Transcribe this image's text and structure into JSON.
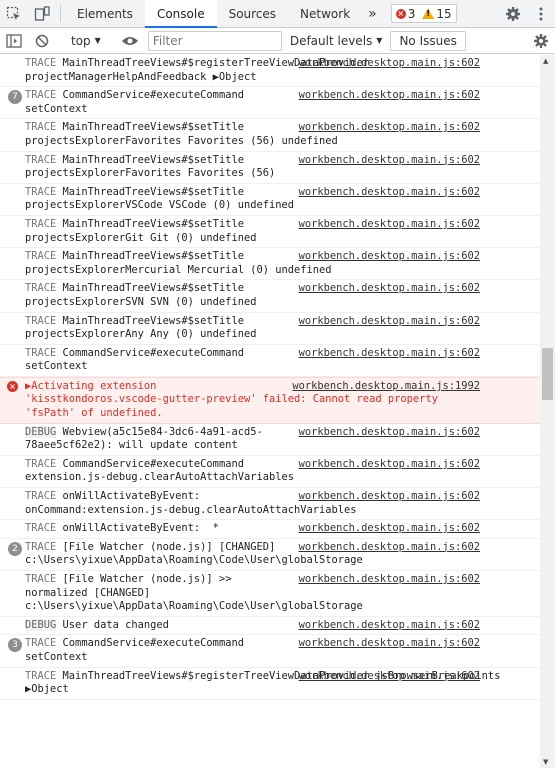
{
  "tabs": [
    {
      "label": "Elements"
    },
    {
      "label": "Console"
    },
    {
      "label": "Sources"
    },
    {
      "label": "Network"
    }
  ],
  "more_tabs": "»",
  "counts": {
    "errors": "3",
    "warnings": "15"
  },
  "toolbar": {
    "context": "top",
    "filter_placeholder": "Filter",
    "levels": "Default levels",
    "issues": "No Issues"
  },
  "colors": {
    "accent": "#1a73e8",
    "error": "#d93025",
    "warning": "#f9ab00"
  },
  "entries": [
    {
      "badge": "",
      "level": "TRACE",
      "source": "workbench.desktop.main.js:602",
      "lines": [
        "MainThreadTreeViews#$registerTreeViewDataProvider",
        "projectManagerHelpAndFeedback ▶Object"
      ]
    },
    {
      "badge": "7",
      "level": "TRACE",
      "source": "workbench.desktop.main.js:602",
      "lines": [
        "CommandService#executeCommand",
        "setContext"
      ]
    },
    {
      "badge": "",
      "level": "TRACE",
      "source": "workbench.desktop.main.js:602",
      "lines": [
        "MainThreadTreeViews#$setTitle",
        "projectsExplorerFavorites Favorites (56) undefined"
      ]
    },
    {
      "badge": "",
      "level": "TRACE",
      "source": "workbench.desktop.main.js:602",
      "lines": [
        "MainThreadTreeViews#$setTitle",
        "projectsExplorerFavorites Favorites (56)"
      ]
    },
    {
      "badge": "",
      "level": "TRACE",
      "source": "workbench.desktop.main.js:602",
      "lines": [
        "MainThreadTreeViews#$setTitle",
        "projectsExplorerVSCode VSCode (0) undefined"
      ]
    },
    {
      "badge": "",
      "level": "TRACE",
      "source": "workbench.desktop.main.js:602",
      "lines": [
        "MainThreadTreeViews#$setTitle",
        "projectsExplorerGit Git (0) undefined"
      ]
    },
    {
      "badge": "",
      "level": "TRACE",
      "source": "workbench.desktop.main.js:602",
      "lines": [
        "MainThreadTreeViews#$setTitle",
        "projectsExplorerMercurial Mercurial (0) undefined"
      ]
    },
    {
      "badge": "",
      "level": "TRACE",
      "source": "workbench.desktop.main.js:602",
      "lines": [
        "MainThreadTreeViews#$setTitle",
        "projectsExplorerSVN SVN (0) undefined"
      ]
    },
    {
      "badge": "",
      "level": "TRACE",
      "source": "workbench.desktop.main.js:602",
      "lines": [
        "MainThreadTreeViews#$setTitle",
        "projectsExplorerAny Any (0) undefined"
      ]
    },
    {
      "badge": "",
      "level": "TRACE",
      "source": "workbench.desktop.main.js:602",
      "lines": [
        "CommandService#executeCommand",
        "setContext"
      ]
    },
    {
      "badge": "",
      "level": "ERROR",
      "source": "workbench.desktop.main.js:1992",
      "lines": [
        "▶Activating extension",
        "'kisstkondoros.vscode-gutter-preview' failed: Cannot read property",
        "'fsPath' of undefined."
      ]
    },
    {
      "badge": "",
      "level": "DEBUG",
      "source": "workbench.desktop.main.js:602",
      "lines": [
        "Webview(a5c15e84-3dc6-4a91-acd5-",
        "78aee5cf62e2): will update content"
      ]
    },
    {
      "badge": "",
      "level": "TRACE",
      "source": "workbench.desktop.main.js:602",
      "lines": [
        "CommandService#executeCommand",
        "extension.js-debug.clearAutoAttachVariables"
      ]
    },
    {
      "badge": "",
      "level": "TRACE",
      "source": "workbench.desktop.main.js:602",
      "lines": [
        "onWillActivateByEvent:",
        "onCommand:extension.js-debug.clearAutoAttachVariables"
      ]
    },
    {
      "badge": "",
      "level": "TRACE",
      "source": "workbench.desktop.main.js:602",
      "lines": [
        "onWillActivateByEvent:  *"
      ]
    },
    {
      "badge": "2",
      "level": "TRACE",
      "source": "workbench.desktop.main.js:602",
      "lines": [
        "[File Watcher (node.js)] [CHANGED]",
        "c:\\Users\\yixue\\AppData\\Roaming\\Code\\User\\globalStorage"
      ]
    },
    {
      "badge": "",
      "level": "TRACE",
      "source": "workbench.desktop.main.js:602",
      "lines": [
        "[File Watcher (node.js)] >>",
        "normalized [CHANGED]",
        "c:\\Users\\yixue\\AppData\\Roaming\\Code\\User\\globalStorage"
      ]
    },
    {
      "badge": "",
      "level": "DEBUG",
      "source": "workbench.desktop.main.js:602",
      "lines": [
        "User data changed"
      ]
    },
    {
      "badge": "3",
      "level": "TRACE",
      "source": "workbench.desktop.main.js:602",
      "lines": [
        "CommandService#executeCommand",
        "setContext"
      ]
    },
    {
      "badge": "",
      "level": "TRACE",
      "source": "workbench.desktop.main.js:602",
      "lines": [
        "MainThreadTreeViews#$registerTreeViewDataProvider jsBrowserBreakpoints",
        "▶Object"
      ]
    }
  ]
}
